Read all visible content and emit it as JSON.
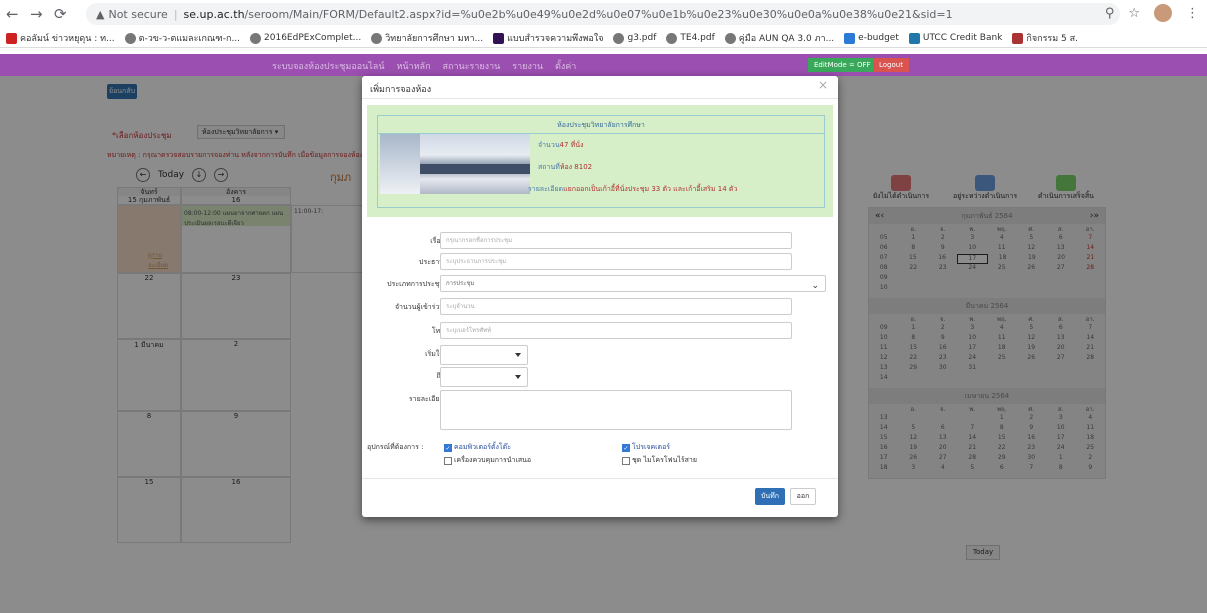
{
  "browser": {
    "url_warning": "Not secure",
    "url_host": "se.up.ac.th",
    "url_path": "/seroom/Main/FORM/Default2.aspx?id=%u0e2b%u0e49%u0e2d%u0e07%u0e1b%u0e23%u0e30%u0e0a%u0e38%u0e21&sid=1",
    "bookmarks": [
      "คอลัมน์ ข่าวหยุดุน : ท...",
      "ต-วข-ว-ตแมละเกณฑ-ก...",
      "2016EdPExComplet...",
      "วิทยาลัยการศึกษา มหา...",
      "แบบสำรวจความพึงพอใจ",
      "g3.pdf",
      "TE4.pdf",
      "คู่มือ AUN QA 3.0 ภา...",
      "e-budget",
      "UTCC Credit Bank",
      "กิจกรรม 5 ส."
    ]
  },
  "navbar": {
    "menu": [
      "ระบบจองห้องประชุมออนไลน์",
      "หน้าหลัก",
      "สถานะรายงาน",
      "รายงาน",
      "ตั้งค่า"
    ],
    "editmode": "EditMode = OFF",
    "logout": "Logout"
  },
  "page": {
    "back": "ย้อนกลับ",
    "room_label": "*เลือกห้องประชุม",
    "room_value": "ห้องประชุมวิทยาลัยการ",
    "note": "หมายเหตุ : กรุณาตรวจสอบรายการจองท่าน หลังจากการบันทึก เมื่อข้อมูลการจองห้องไ",
    "today": "Today",
    "month_short": "กุมภ",
    "grid_headers": [
      "จันทร์",
      "อังคาร"
    ],
    "dates": [
      "15 กุมภาพันธ์",
      "16",
      "22",
      "23",
      "1 มีนาคม",
      "2",
      "8",
      "9",
      "15",
      "16"
    ],
    "event_text": "08:00-12:00 แผนยาจากศายตก แผนประเมินผลเรอบะดีเจียว",
    "event_text2": "11:00-17:",
    "more": "ดูรายละเอียด"
  },
  "legend": [
    {
      "label": "ยังไม่ได้ดำเนินการ",
      "color": "#e87878"
    },
    {
      "label": "อยู่ระหว่างดำเนินการ",
      "color": "#6c9ee0"
    },
    {
      "label": "ดำเนินการเสร็จสิ้น",
      "color": "#7cd56c"
    }
  ],
  "minical": {
    "dow": [
      "อ.",
      "จ.",
      "พ.",
      "พฤ.",
      "ศ.",
      "ส.",
      "อา."
    ],
    "months": [
      {
        "name": "กุมภาพันธ์ 2564",
        "weeks": [
          [
            "05",
            "1",
            "2",
            "3",
            "4",
            "5",
            "6",
            "7"
          ],
          [
            "06",
            "8",
            "9",
            "10",
            "11",
            "12",
            "13",
            "14"
          ],
          [
            "07",
            "15",
            "16",
            "17",
            "18",
            "19",
            "20",
            "21"
          ],
          [
            "08",
            "22",
            "23",
            "24",
            "25",
            "26",
            "27",
            "28"
          ],
          [
            "09",
            "",
            "",
            "",
            "",
            "",
            "",
            ""
          ],
          [
            "10",
            "",
            "",
            "",
            "",
            "",
            "",
            ""
          ]
        ]
      },
      {
        "name": "มีนาคม 2564",
        "weeks": [
          [
            "09",
            "1",
            "2",
            "3",
            "4",
            "5",
            "6",
            "7"
          ],
          [
            "10",
            "8",
            "9",
            "10",
            "11",
            "12",
            "13",
            "14"
          ],
          [
            "11",
            "15",
            "16",
            "17",
            "18",
            "19",
            "20",
            "21"
          ],
          [
            "12",
            "22",
            "23",
            "24",
            "25",
            "26",
            "27",
            "28"
          ],
          [
            "13",
            "29",
            "30",
            "31",
            "",
            "",
            "",
            ""
          ],
          [
            "14",
            "",
            "",
            "",
            "",
            "",
            "",
            ""
          ]
        ]
      },
      {
        "name": "เมษายน 2564",
        "weeks": [
          [
            "13",
            "",
            "",
            "",
            "1",
            "2",
            "3",
            "4"
          ],
          [
            "14",
            "5",
            "6",
            "7",
            "8",
            "9",
            "10",
            "11"
          ],
          [
            "15",
            "12",
            "13",
            "14",
            "15",
            "16",
            "17",
            "18"
          ],
          [
            "16",
            "19",
            "20",
            "21",
            "22",
            "23",
            "24",
            "25"
          ],
          [
            "17",
            "26",
            "27",
            "28",
            "29",
            "30",
            "1",
            "2"
          ],
          [
            "18",
            "3",
            "4",
            "5",
            "6",
            "7",
            "8",
            "9"
          ]
        ]
      }
    ],
    "today": "Today"
  },
  "modal": {
    "title": "เพิ่มการจองห้อง",
    "close": "×",
    "room_title": "ห้องประชุมวิทยาลัยการศึกษา",
    "capacity_label": "จำนวน",
    "capacity_value": "47 ที่นั่ง",
    "location_label": "สถานที่",
    "location_value": "ห้อง 8102",
    "detail_label": "รายละเอียด",
    "detail_value": "แยกออกเป็นเก้าอี้ที่นั่งประชุม 33 ตัว และเก้าอี้เสริม 14 ตัว",
    "fields": {
      "subject_label": "เรื่อง",
      "subject_ph": "กรุณากรอกชื่อการประชุม",
      "chair_label": "ประธาน",
      "chair_ph": "ระบุประธานการประชุม",
      "type_label": "ประเภทการประชุม",
      "type_value": "การประชุม",
      "count_label": "จำนวนผู้เข้าร่วม",
      "count_ph": "ระบุจำนวน",
      "phone_label": "โทร",
      "phone_ph": "ระบุเบอร์โทรศัพท์",
      "start_label": "เริ่มใช้",
      "end_label": "ถึง",
      "detail_label": "รายละเอียด"
    },
    "equip_label": "อุปกรณ์ที่ต้องการ :",
    "equip": [
      {
        "label": "คอมพิวเตอร์ตั้งโต๊ะ",
        "checked": true
      },
      {
        "label": "โปรเจคเตอร์",
        "checked": true
      },
      {
        "label": "เครื่องควบคุมการนำเสนอ",
        "checked": false
      },
      {
        "label": "ชุด ไมโครโฟนไร้สาย",
        "checked": false
      }
    ],
    "save": "บันทึก",
    "cancel": "ออก"
  }
}
